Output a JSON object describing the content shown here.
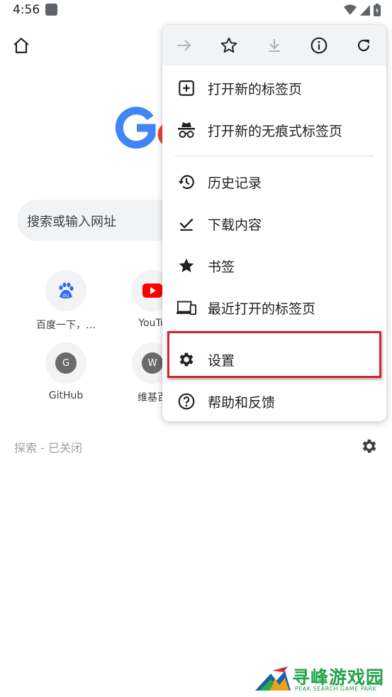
{
  "status_bar": {
    "time": "4:56"
  },
  "new_tab_page": {
    "search_placeholder": "搜索或输入网址",
    "shortcuts": [
      {
        "label": "百度一下，…",
        "icon": "baidu-icon"
      },
      {
        "label": "YouTu",
        "icon": "youtube-icon"
      },
      {
        "label": "GitHub",
        "letter": "G"
      },
      {
        "label": "维基百",
        "letter": "W"
      }
    ],
    "discover_label": "探索 - 已关闭"
  },
  "menu": {
    "toolbar": [
      "forward-icon",
      "star-outline-icon",
      "download-icon",
      "info-icon",
      "refresh-icon"
    ],
    "items": [
      {
        "label": "打开新的标签页",
        "icon": "new-tab-icon"
      },
      {
        "label": "打开新的无痕式标签页",
        "icon": "incognito-icon"
      },
      {
        "label": "历史记录",
        "icon": "history-icon"
      },
      {
        "label": "下载内容",
        "icon": "downloads-icon"
      },
      {
        "label": "书签",
        "icon": "bookmark-star-icon"
      },
      {
        "label": "最近打开的标签页",
        "icon": "recent-tabs-icon"
      },
      {
        "label": "设置",
        "icon": "settings-gear-icon"
      },
      {
        "label": "帮助和反馈",
        "icon": "help-icon"
      }
    ]
  },
  "highlight_color": "#d6262e",
  "watermark": {
    "title": "寻峰游戏园",
    "subtitle": "PEAK SEARCH GAME PARK"
  }
}
